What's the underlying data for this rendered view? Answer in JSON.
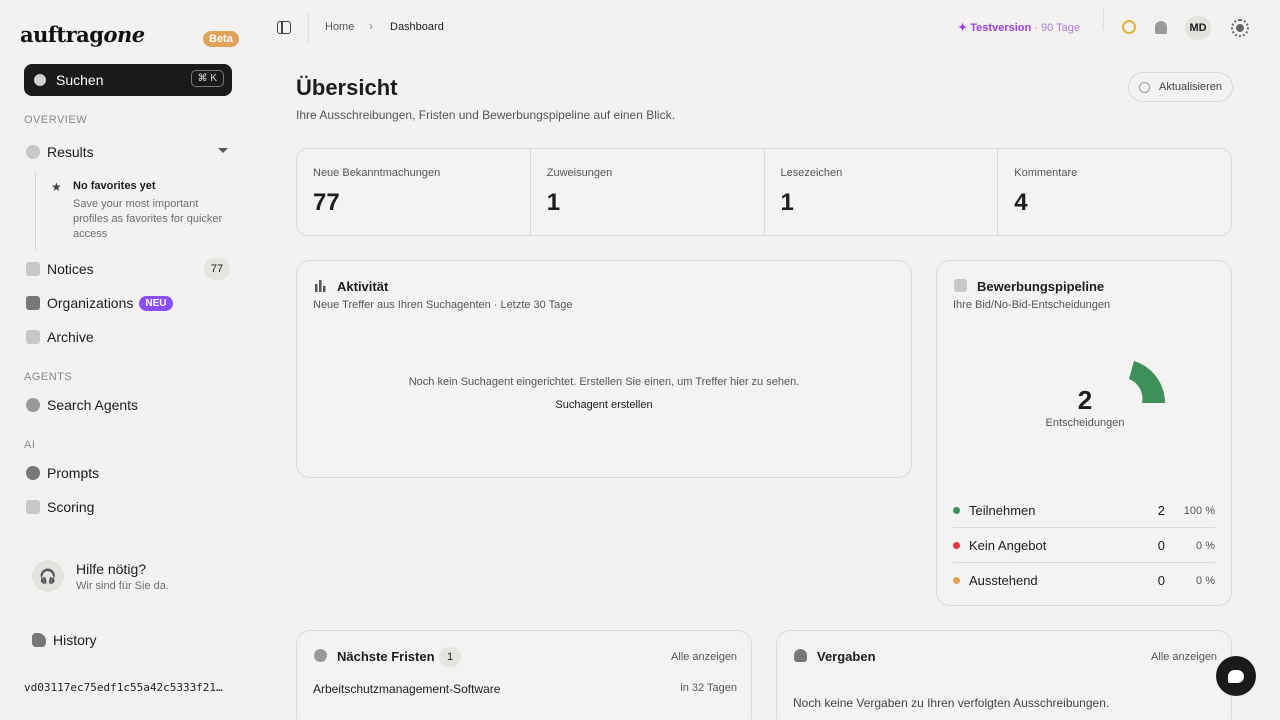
{
  "brand": {
    "logo_main": "auftrag",
    "logo_accent": "one",
    "beta": "Beta"
  },
  "search": {
    "label": "Suchen",
    "shortcut": "⌘ K"
  },
  "sidebar": {
    "sections": {
      "overview": "OVERVIEW",
      "agents": "AGENTS",
      "ai": "AI"
    },
    "items": {
      "results": "Results",
      "notices": "Notices",
      "notices_count": "77",
      "organizations": "Organizations",
      "organizations_badge": "NEU",
      "archive": "Archive",
      "search_agents": "Search Agents",
      "prompts": "Prompts",
      "scoring": "Scoring",
      "history": "History"
    },
    "favorites": {
      "title": "No favorites yet",
      "desc": "Save your most important profiles as favorites for quicker access"
    },
    "help": {
      "title": "Hilfe nötig?",
      "sub": "Wir sind für Sie da."
    },
    "hash": "vd03117ec75edf1c55a42c5333f21…"
  },
  "topbar": {
    "breadcrumb": [
      "Home",
      "Dashboard"
    ],
    "trial": {
      "label": "Testversion",
      "days": "· 90 Tage"
    },
    "avatar": "MD"
  },
  "page": {
    "title": "Übersicht",
    "subtitle": "Ihre Ausschreibungen, Fristen und Bewerbungspipeline auf einen Blick.",
    "refresh": "Aktualisieren"
  },
  "stats": [
    {
      "label": "Neue Bekanntmachungen",
      "value": "77"
    },
    {
      "label": "Zuweisungen",
      "value": "1"
    },
    {
      "label": "Lesezeichen",
      "value": "1"
    },
    {
      "label": "Kommentare",
      "value": "4"
    }
  ],
  "activity": {
    "title": "Aktivität",
    "subtitle": "Neue Treffer aus Ihren Suchagenten · Letzte 30 Tage",
    "empty": "Noch kein Suchagent eingerichtet. Erstellen Sie einen, um Treffer hier zu sehen.",
    "cta": "Suchagent erstellen"
  },
  "pipeline": {
    "title": "Bewerbungspipeline",
    "subtitle": "Ihre Bid/No-Bid-Entscheidungen",
    "total": "2",
    "total_label": "Entscheidungen",
    "rows": [
      {
        "name": "Teilnehmen",
        "count": "2",
        "pct": "100 %",
        "color": "#3f8f5a"
      },
      {
        "name": "Kein Angebot",
        "count": "0",
        "pct": "0 %",
        "color": "#e5333f"
      },
      {
        "name": "Ausstehend",
        "count": "0",
        "pct": "0 %",
        "color": "#e0a15a"
      }
    ]
  },
  "deadlines": {
    "title": "Nächste Fristen",
    "count": "1",
    "link": "Alle anzeigen",
    "rows": [
      {
        "name": "Arbeitschutzmanagement-Software",
        "due": "in 32 Tagen"
      }
    ]
  },
  "awards": {
    "title": "Vergaben",
    "link": "Alle anzeigen",
    "empty": "Noch keine Vergaben zu Ihren verfolgten Ausschreibungen."
  }
}
